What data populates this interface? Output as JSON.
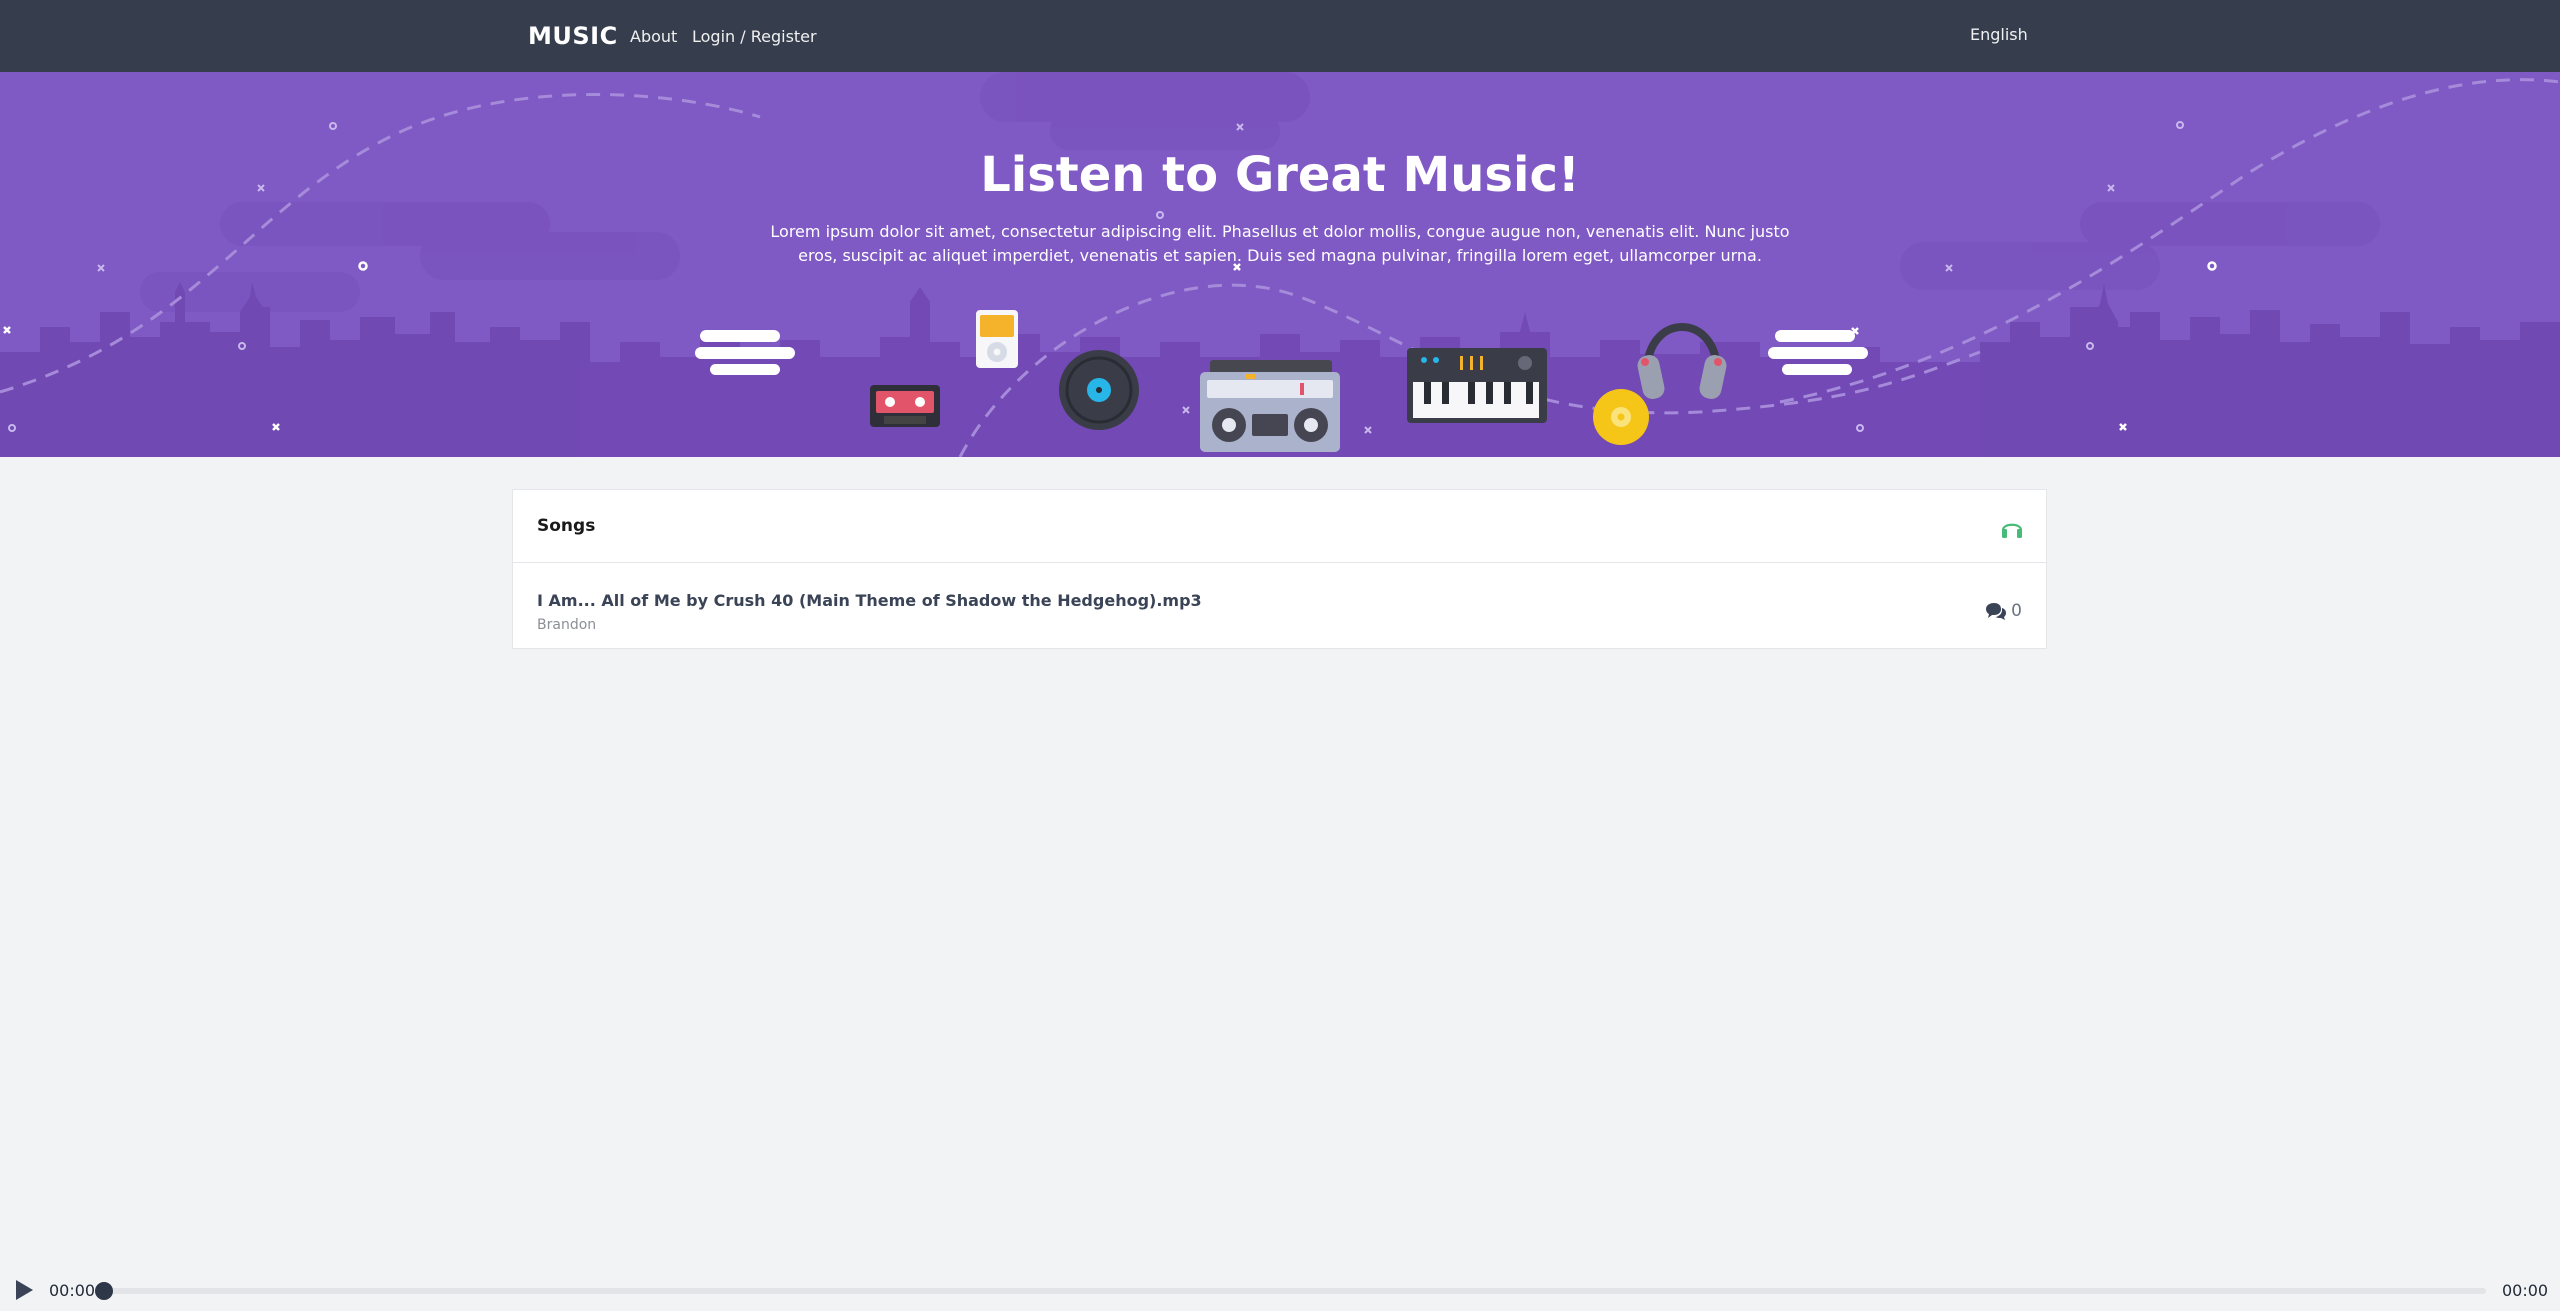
{
  "navbar": {
    "brand": "MUSIC",
    "links": [
      "About",
      "Login / Register"
    ],
    "language": "English"
  },
  "hero": {
    "title": "Listen to Great Music!",
    "text": "Lorem ipsum dolor sit amet, consectetur adipiscing elit. Phasellus et dolor mollis, congue augue non, venenatis elit. Nunc justo eros, suscipit ac aliquet imperdiet, venenatis et sapien. Duis sed magna pulvinar, fringilla lorem eget, ullamcorper urna."
  },
  "songs": {
    "title": "Songs",
    "icon": "headphones-icon",
    "items": [
      {
        "title": "I Am... All of Me by Crush 40 (Main Theme of Shadow the Hedgehog).mp3",
        "artist": "Brandon",
        "comments": "0"
      }
    ]
  },
  "player": {
    "current_time": "00:00",
    "total_time": "00:00",
    "progress": 0
  },
  "colors": {
    "navbar": "#363e4e",
    "hero": "#7f59c4",
    "accent_green": "#48bb78",
    "background": "#f2f3f5"
  }
}
